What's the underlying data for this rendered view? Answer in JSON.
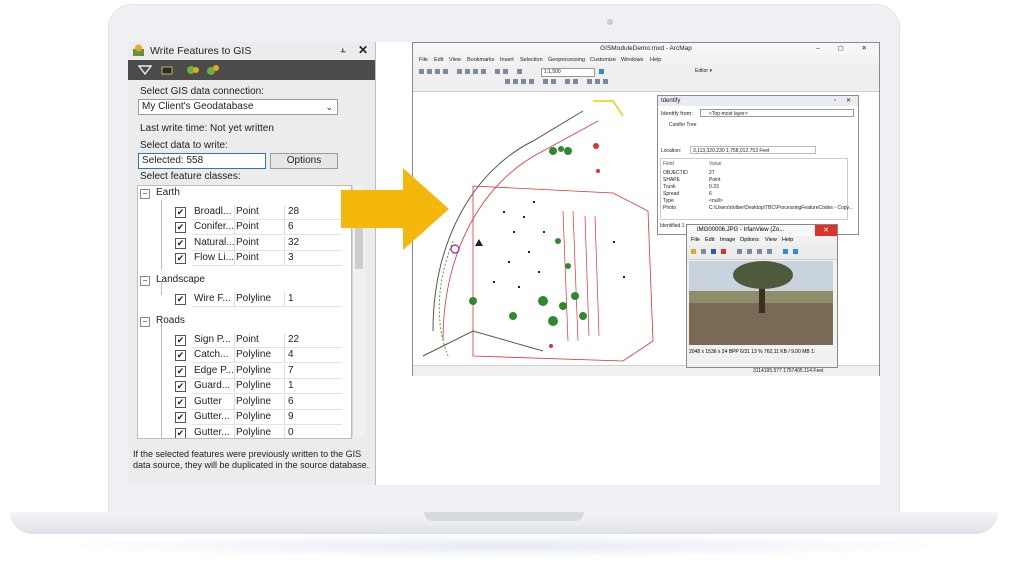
{
  "panel": {
    "title": "Write Features to GIS",
    "toolbar_icons": [
      "filter-icon",
      "layer-icon",
      "export-icon",
      "sync-icon"
    ],
    "connection_label": "Select GIS data connection:",
    "connection_value": "My Client's Geodatabase",
    "last_write": "Last write time: Not yet written",
    "data_label": "Select data to write:",
    "selected_value": "Selected: 558",
    "options_button": "Options",
    "classes_label": "Select feature classes:",
    "groups": [
      {
        "name": "Earth",
        "expander": "−",
        "rows": [
          {
            "name": "Broadl...",
            "type": "Point",
            "count": "28"
          },
          {
            "name": "Conifer...",
            "type": "Point",
            "count": "6"
          },
          {
            "name": "Natural...",
            "type": "Point",
            "count": "32"
          },
          {
            "name": "Flow Li...",
            "type": "Point",
            "count": "3"
          }
        ]
      },
      {
        "name": "Landscape",
        "expander": "−",
        "rows": [
          {
            "name": "Wire F...",
            "type": "Polyline",
            "count": "1"
          }
        ]
      },
      {
        "name": "Roads",
        "expander": "−",
        "rows": [
          {
            "name": "Sign P...",
            "type": "Point",
            "count": "22"
          },
          {
            "name": "Catch...",
            "type": "Polyline",
            "count": "4"
          },
          {
            "name": "Edge P...",
            "type": "Polyline",
            "count": "7"
          },
          {
            "name": "Guard...",
            "type": "Polyline",
            "count": "1"
          },
          {
            "name": "Gutter",
            "type": "Polyline",
            "count": "6"
          },
          {
            "name": "Gutter...",
            "type": "Polyline",
            "count": "9"
          },
          {
            "name": "Gutter...",
            "type": "Polyline",
            "count": "0"
          }
        ]
      }
    ],
    "check": "✔",
    "footer": "If the selected features were previously written to the GIS data source, they will be duplicated in the source database."
  },
  "arcmap": {
    "title": "GISModuleDemo.mxd - ArcMap",
    "menu": [
      "File",
      "Edit",
      "View",
      "Bookmarks",
      "Insert",
      "Selection",
      "Geoprocessing",
      "Customize",
      "Windows",
      "Help"
    ],
    "scale": "1:1,500",
    "editor": "Editor ▾",
    "status_coords": "3114195.577  1757405.114 Feet"
  },
  "identify": {
    "title": "Identify",
    "from_label": "Identify from:",
    "from_value": "<Top-most layer>",
    "tree_item": "Conifer Tree",
    "location_label": "Location:",
    "location_value": "3,113,320.230  1,758,012.753 Feet",
    "header_field": "Field",
    "header_value": "Value",
    "rows": [
      {
        "field": "OBJECTID",
        "value": "27"
      },
      {
        "field": "SHAPE",
        "value": "Point"
      },
      {
        "field": "Trunk",
        "value": "0.33"
      },
      {
        "field": "Spread",
        "value": "6"
      },
      {
        "field": "Type",
        "value": "<null>"
      },
      {
        "field": "Photo",
        "value": "C:\\Users\\rtolber\\Desktop\\TBC\\ProcessingFeatureCodes - Copy..."
      }
    ],
    "footer": "Identified 1"
  },
  "irfan": {
    "title": "IMG00006.JPG - IrfanView (Zo...",
    "close": "✕",
    "menu": [
      "File",
      "Edit",
      "Image",
      "Options",
      "View",
      "Help"
    ],
    "status": "2048 x 1536 x 24 BPP    6/31    13 %    762,11 KB / 9.00 MB    1:"
  },
  "colors": {
    "arrow": "#f3b80b",
    "panel_bg": "#ececec",
    "toolbar_bg": "#4b4b4b",
    "selection_border": "#2a73c5"
  }
}
